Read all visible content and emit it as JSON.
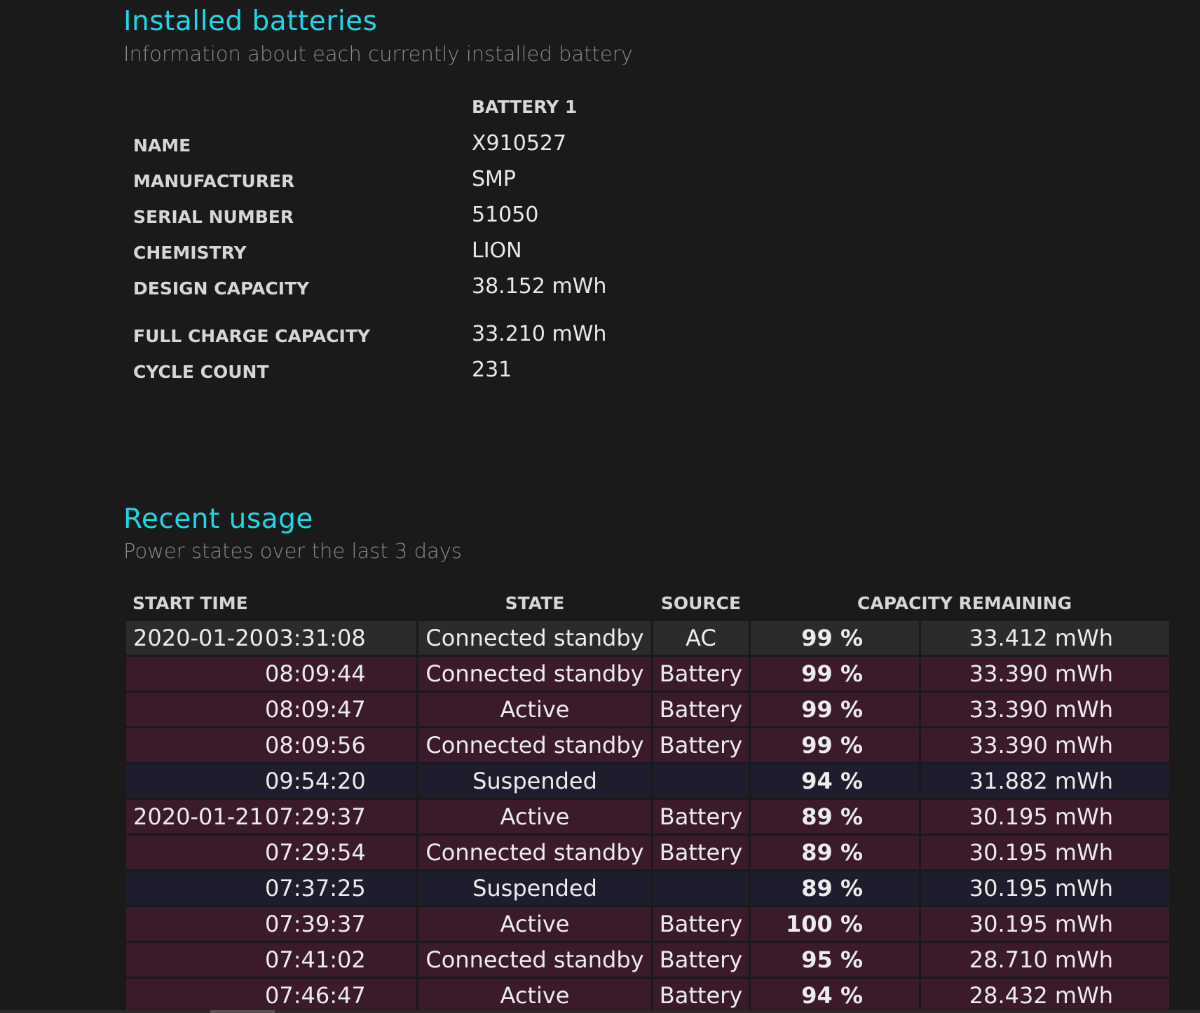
{
  "installed": {
    "title": "Installed batteries",
    "subtitle": "Information about each currently installed battery",
    "column_header": "BATTERY 1",
    "rows": [
      {
        "label": "NAME",
        "value": "X910527"
      },
      {
        "label": "MANUFACTURER",
        "value": "SMP"
      },
      {
        "label": "SERIAL NUMBER",
        "value": "51050"
      },
      {
        "label": "CHEMISTRY",
        "value": "LION"
      },
      {
        "label": "DESIGN CAPACITY",
        "value": "38.152 mWh"
      },
      {
        "label": "FULL CHARGE CAPACITY",
        "value": "33.210 mWh"
      },
      {
        "label": "CYCLE COUNT",
        "value": "231"
      }
    ]
  },
  "usage": {
    "title": "Recent usage",
    "subtitle": "Power states over the last 3 days",
    "headers": {
      "start_time": "START TIME",
      "state": "STATE",
      "source": "SOURCE",
      "capacity": "CAPACITY REMAINING"
    },
    "rows": [
      {
        "date": "2020-01-20",
        "time": "03:31:08",
        "state": "Connected standby",
        "source": "AC",
        "percent": "99 %",
        "capacity": "33.412 mWh",
        "tone": "ac"
      },
      {
        "date": "",
        "time": "08:09:44",
        "state": "Connected standby",
        "source": "Battery",
        "percent": "99 %",
        "capacity": "33.390 mWh",
        "tone": "battery"
      },
      {
        "date": "",
        "time": "08:09:47",
        "state": "Active",
        "source": "Battery",
        "percent": "99 %",
        "capacity": "33.390 mWh",
        "tone": "battery"
      },
      {
        "date": "",
        "time": "08:09:56",
        "state": "Connected standby",
        "source": "Battery",
        "percent": "99 %",
        "capacity": "33.390 mWh",
        "tone": "battery"
      },
      {
        "date": "",
        "time": "09:54:20",
        "state": "Suspended",
        "source": "",
        "percent": "94 %",
        "capacity": "31.882 mWh",
        "tone": "suspended"
      },
      {
        "date": "2020-01-21",
        "time": "07:29:37",
        "state": "Active",
        "source": "Battery",
        "percent": "89 %",
        "capacity": "30.195 mWh",
        "tone": "battery"
      },
      {
        "date": "",
        "time": "07:29:54",
        "state": "Connected standby",
        "source": "Battery",
        "percent": "89 %",
        "capacity": "30.195 mWh",
        "tone": "battery"
      },
      {
        "date": "",
        "time": "07:37:25",
        "state": "Suspended",
        "source": "",
        "percent": "89 %",
        "capacity": "30.195 mWh",
        "tone": "suspended"
      },
      {
        "date": "",
        "time": "07:39:37",
        "state": "Active",
        "source": "Battery",
        "percent": "100 %",
        "capacity": "30.195 mWh",
        "tone": "battery"
      },
      {
        "date": "",
        "time": "07:41:02",
        "state": "Connected standby",
        "source": "Battery",
        "percent": "95 %",
        "capacity": "28.710 mWh",
        "tone": "battery"
      },
      {
        "date": "",
        "time": "07:46:47",
        "state": "Active",
        "source": "Battery",
        "percent": "94 %",
        "capacity": "28.432 mWh",
        "tone": "battery"
      }
    ]
  }
}
